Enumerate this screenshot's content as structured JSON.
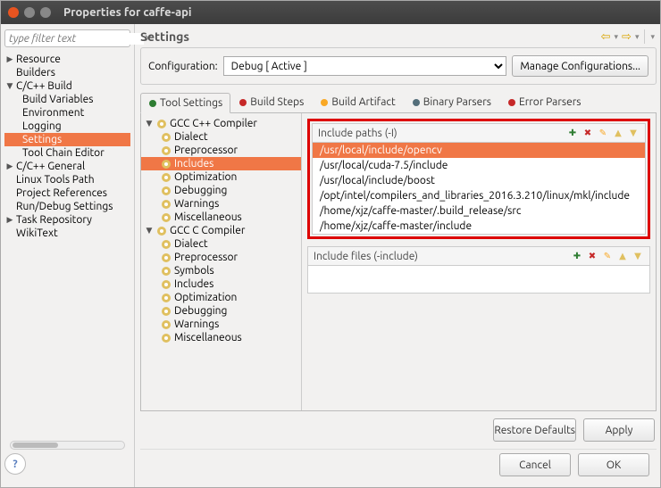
{
  "window": {
    "title": "Properties for caffe-api"
  },
  "filter": {
    "placeholder": "type filter text"
  },
  "nav": {
    "items": [
      {
        "label": "Resource",
        "exp": "▶"
      },
      {
        "label": "Builders",
        "exp": ""
      },
      {
        "label": "C/C++ Build",
        "exp": "▼",
        "children": [
          {
            "label": "Build Variables"
          },
          {
            "label": "Environment"
          },
          {
            "label": "Logging"
          },
          {
            "label": "Settings",
            "selected": true
          },
          {
            "label": "Tool Chain Editor"
          }
        ]
      },
      {
        "label": "C/C++ General",
        "exp": "▶"
      },
      {
        "label": "Linux Tools Path",
        "exp": ""
      },
      {
        "label": "Project References",
        "exp": ""
      },
      {
        "label": "Run/Debug Settings",
        "exp": ""
      },
      {
        "label": "Task Repository",
        "exp": "▶"
      },
      {
        "label": "WikiText",
        "exp": ""
      }
    ]
  },
  "heading": "Settings",
  "config": {
    "label": "Configuration:",
    "value": "Debug  [ Active ]",
    "manage": "Manage Configurations..."
  },
  "tabs": [
    {
      "label": "Tool Settings",
      "active": true,
      "color": "#2e7d32"
    },
    {
      "label": "Build Steps",
      "color": "#c62828"
    },
    {
      "label": "Build Artifact",
      "color": "#f9a825"
    },
    {
      "label": "Binary Parsers",
      "color": "#546e7a"
    },
    {
      "label": "Error Parsers",
      "color": "#c62828"
    }
  ],
  "toolTree": [
    {
      "label": "GCC C++ Compiler",
      "exp": "▼",
      "header": true,
      "children": [
        {
          "label": "Dialect"
        },
        {
          "label": "Preprocessor"
        },
        {
          "label": "Includes",
          "selected": true
        },
        {
          "label": "Optimization"
        },
        {
          "label": "Debugging"
        },
        {
          "label": "Warnings"
        },
        {
          "label": "Miscellaneous"
        }
      ]
    },
    {
      "label": "GCC C Compiler",
      "exp": "▼",
      "header": true,
      "children": [
        {
          "label": "Dialect"
        },
        {
          "label": "Preprocessor"
        },
        {
          "label": "Symbols"
        },
        {
          "label": "Includes"
        },
        {
          "label": "Optimization"
        },
        {
          "label": "Debugging"
        },
        {
          "label": "Warnings"
        },
        {
          "label": "Miscellaneous"
        }
      ]
    }
  ],
  "includePaths": {
    "title": "Include paths (-I)",
    "items": [
      "/usr/local/include/opencv",
      "/usr/local/cuda-7.5/include",
      "/usr/local/include/boost",
      "/opt/intel/compilers_and_libraries_2016.3.210/linux/mkl/include",
      "/home/xjz/caffe-master/.build_release/src",
      "/home/xjz/caffe-master/include"
    ]
  },
  "includeFiles": {
    "title": "Include files (-include)"
  },
  "buttons": {
    "restore": "Restore Defaults",
    "apply": "Apply",
    "cancel": "Cancel",
    "ok": "OK"
  },
  "iconColors": {
    "add": "#2e7d32",
    "delete": "#c62828",
    "edit": "#f9a825",
    "up": "#e0c060",
    "down": "#e0c060"
  }
}
